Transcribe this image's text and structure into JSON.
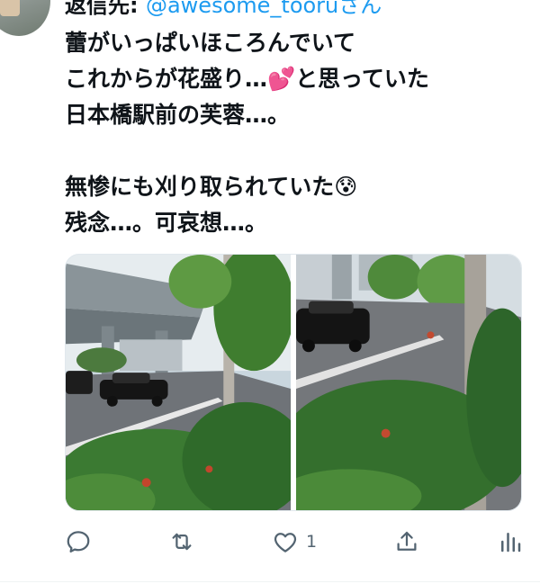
{
  "reply": {
    "prefix": "返信先:",
    "handle": "@awesome_tooruさん"
  },
  "tweet": {
    "lines": [
      "蕾がいっぱいほころんでいて",
      "これからが花盛り…💕と思っていた",
      "日本橋駅前の芙蓉…。",
      "無惨にも刈り取られていた😰",
      "残念…。可哀想…。"
    ]
  },
  "media": {
    "photos": [
      {
        "icon": "photo-street-taxi-left"
      },
      {
        "icon": "photo-street-taxi-right"
      }
    ]
  },
  "actions": {
    "reply_icon": "reply-icon",
    "retweet_icon": "retweet-icon",
    "like_icon": "heart-icon",
    "like_count": "1",
    "share_icon": "share-icon",
    "views_icon": "analytics-icon"
  },
  "colors": {
    "text": "#0f1419",
    "link": "#1d9bf0",
    "muted": "#536471"
  }
}
